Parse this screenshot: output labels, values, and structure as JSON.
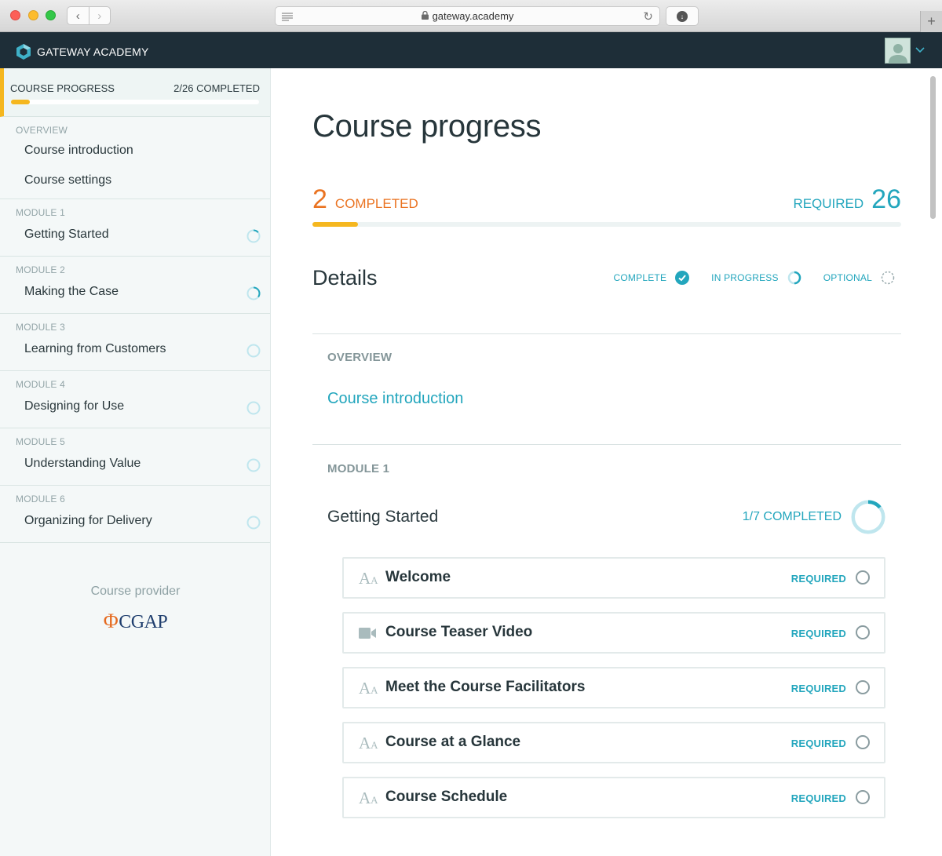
{
  "browser": {
    "url": "gateway.academy"
  },
  "header": {
    "brand": "GATEWAY ACADEMY",
    "colors": {
      "bar": "#1e2e38",
      "accent": "#3fb1c8"
    }
  },
  "sidebar": {
    "progress_title": "COURSE PROGRESS",
    "progress_count": "2/26 COMPLETED",
    "progress_fraction": 0.077,
    "groups": [
      {
        "label": "OVERVIEW",
        "items": [
          {
            "label": "Course introduction"
          },
          {
            "label": "Course settings"
          }
        ]
      },
      {
        "label": "MODULE 1",
        "items": [
          {
            "label": "Getting Started",
            "status": "in-progress",
            "progress": 0.14
          }
        ]
      },
      {
        "label": "MODULE 2",
        "items": [
          {
            "label": "Making the Case",
            "status": "in-progress",
            "progress": 0.35
          }
        ]
      },
      {
        "label": "MODULE 3",
        "items": [
          {
            "label": "Learning from Customers",
            "status": "not-started",
            "progress": 0
          }
        ]
      },
      {
        "label": "MODULE 4",
        "items": [
          {
            "label": "Designing for Use",
            "status": "not-started",
            "progress": 0
          }
        ]
      },
      {
        "label": "MODULE 5",
        "items": [
          {
            "label": "Understanding Value",
            "status": "not-started",
            "progress": 0
          }
        ]
      },
      {
        "label": "MODULE 6",
        "items": [
          {
            "label": "Organizing for Delivery",
            "status": "not-started",
            "progress": 0
          }
        ]
      }
    ],
    "provider_label": "Course provider",
    "provider_logo_text": "CGAP"
  },
  "main": {
    "title": "Course progress",
    "completed_count": "2",
    "completed_label": "COMPLETED",
    "required_label": "REQUIRED",
    "required_count": "26",
    "progress_fraction": 0.077,
    "details_title": "Details",
    "legend": {
      "complete": "COMPLETE",
      "in_progress": "IN PROGRESS",
      "optional": "OPTIONAL"
    },
    "overview": {
      "label": "OVERVIEW",
      "link": "Course introduction"
    },
    "module1": {
      "label": "MODULE 1",
      "title": "Getting Started",
      "count": "1/7 COMPLETED",
      "progress_fraction": 0.14,
      "lessons": [
        {
          "title": "Welcome",
          "icon": "text-icon",
          "tag": "REQUIRED"
        },
        {
          "title": "Course Teaser Video",
          "icon": "video-icon",
          "tag": "REQUIRED"
        },
        {
          "title": "Meet the Course Facilitators",
          "icon": "text-icon",
          "tag": "REQUIRED"
        },
        {
          "title": "Course at a Glance",
          "icon": "text-icon",
          "tag": "REQUIRED"
        },
        {
          "title": "Course Schedule",
          "icon": "text-icon",
          "tag": "REQUIRED"
        }
      ]
    },
    "colors": {
      "orange": "#ea7321",
      "teal": "#23a6bd",
      "yellow": "#f5b71f"
    }
  }
}
